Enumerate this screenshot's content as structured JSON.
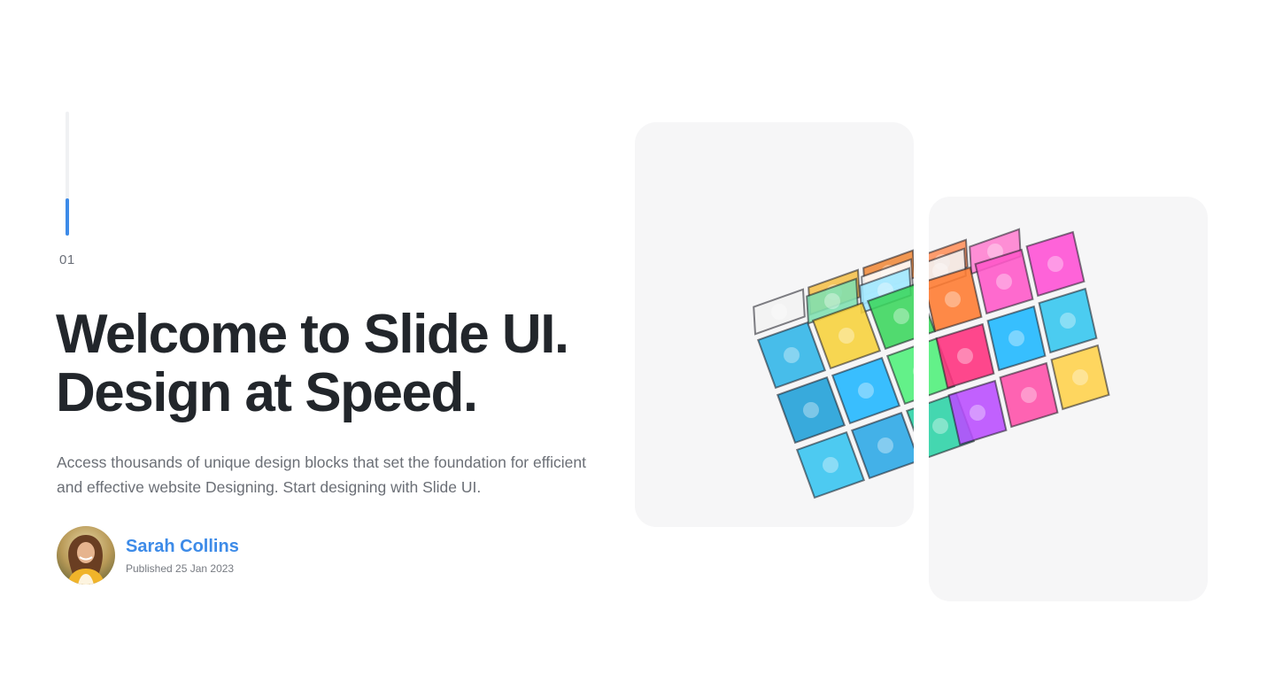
{
  "slide": {
    "number": "01",
    "progress": 0.3
  },
  "hero": {
    "title_line1": "Welcome to Slide UI.",
    "title_line2": "Design at Speed.",
    "description": "Access thousands of unique design blocks that set the foundation for efficient and effective website Designing. Start designing with Slide UI."
  },
  "author": {
    "name": "Sarah Collins",
    "published": "Published 25 Jan 2023",
    "avatar_icon": "person-photo"
  },
  "image": {
    "icon": "rubiks-cube-illustration"
  },
  "colors": {
    "accent": "#3d8be8",
    "heading": "#22262b",
    "body_text": "#6b6f76",
    "panel_bg": "#f6f6f7"
  }
}
